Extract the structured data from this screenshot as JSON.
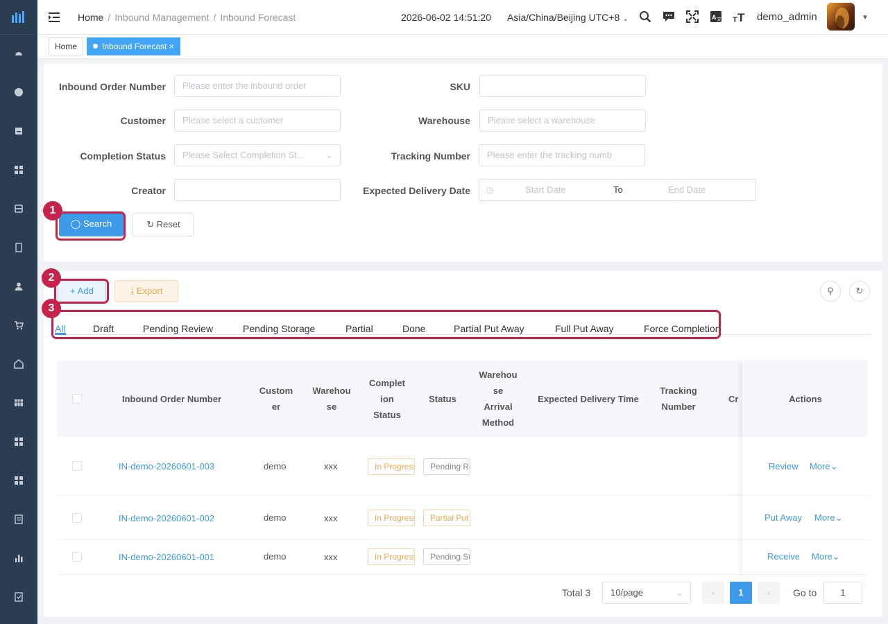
{
  "header": {
    "breadcrumb": [
      "Home",
      "Inbound Management",
      "Inbound Forecast"
    ],
    "datetime": "2026-06-02 14:51:20",
    "timezone": "Asia/China/Beijing UTC+8",
    "username": "demo_admin"
  },
  "tags": {
    "home": "Home",
    "current": "Inbound Forecast"
  },
  "filters": {
    "inbound_order_number": {
      "label": "Inbound Order Number",
      "placeholder": "Please enter the inbound order"
    },
    "sku": {
      "label": "SKU",
      "placeholder": ""
    },
    "customer": {
      "label": "Customer",
      "placeholder": "Please select a customer"
    },
    "warehouse": {
      "label": "Warehouse",
      "placeholder": "Please select a warehouse"
    },
    "completion_status": {
      "label": "Completion Status",
      "placeholder": "Please Select Completion St..."
    },
    "tracking_number": {
      "label": "Tracking Number",
      "placeholder": "Please enter the tracking numb"
    },
    "creator": {
      "label": "Creator",
      "placeholder": ""
    },
    "expected_delivery_date": {
      "label": "Expected Delivery Date",
      "start": "Start Date",
      "to": "To",
      "end": "End Date"
    },
    "search_label": "Search",
    "reset_label": "Reset"
  },
  "toolbar": {
    "add_label": "Add",
    "export_label": "Export"
  },
  "callouts": [
    "1",
    "2",
    "3"
  ],
  "status_tabs": [
    "All",
    "Draft",
    "Pending Review",
    "Pending Storage",
    "Partial",
    "Done",
    "Partial Put Away",
    "Full Put Away",
    "Force Completion"
  ],
  "table": {
    "headers": {
      "order_number": "Inbound Order Number",
      "customer": "Custom\ner",
      "warehouse": "Warehou\nse",
      "completion": "Complet\nion\nStatus",
      "status": "Status",
      "arrival": "Warehou\nse\nArrival\nMethod",
      "expected": "Expected Delivery Time",
      "tracking": "Tracking\nNumber",
      "creator": "Cr",
      "actions": "Actions"
    },
    "rows": [
      {
        "order": "IN-demo-20260601-003",
        "customer": "demo",
        "warehouse": "xxx",
        "completion": "In Progress",
        "status": "Pending Review",
        "action": "Review",
        "more": "More"
      },
      {
        "order": "IN-demo-20260601-002",
        "customer": "demo",
        "warehouse": "xxx",
        "completion": "In Progress",
        "status": "Partial Put Away",
        "action": "Put Away",
        "more": "More"
      },
      {
        "order": "IN-demo-20260601-001",
        "customer": "demo",
        "warehouse": "xxx",
        "completion": "In Progress",
        "status": "Pending Storage",
        "action": "Receive",
        "more": "More"
      }
    ]
  },
  "pagination": {
    "total": "Total 3",
    "page_size": "10/page",
    "current_page": "1",
    "goto_label": "Go to",
    "goto_value": "1"
  },
  "colors": {
    "sidebar": "#2b3d51",
    "primary": "#3d9be9",
    "highlight": "#c8224a",
    "warning": "#f0a850"
  },
  "icons": [
    "menu-fold-icon",
    "search-icon",
    "message-icon",
    "fullscreen-icon",
    "translate-icon",
    "font-size-icon",
    "refresh-icon",
    "calendar-icon",
    "plus-icon",
    "download-icon",
    "chevron-down-icon"
  ]
}
